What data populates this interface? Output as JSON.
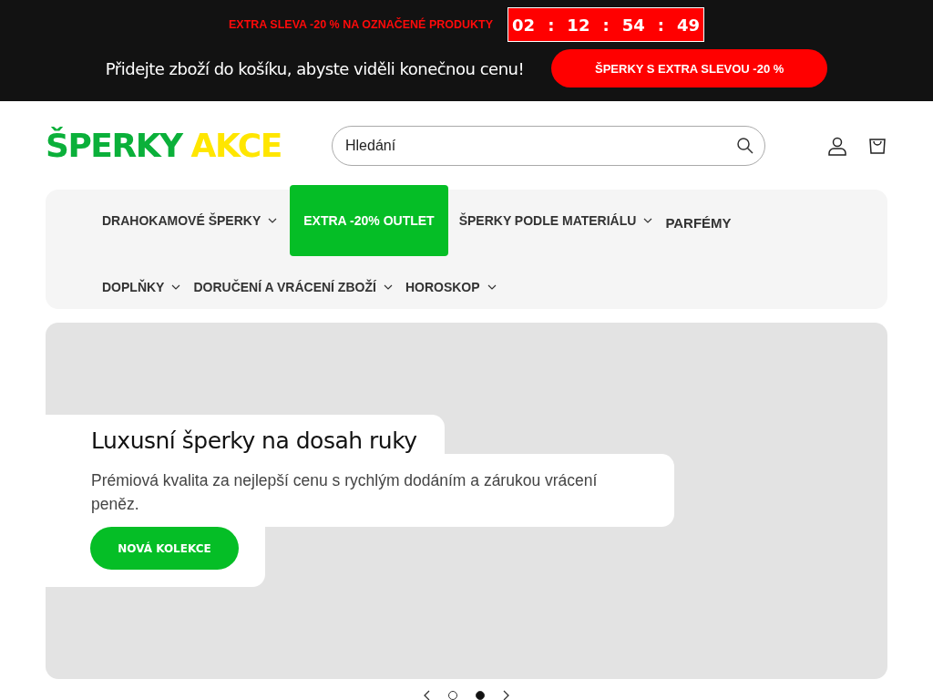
{
  "announcement": {
    "promo_text": "EXTRA SLEVA -20 % NA OZNAČENÉ PRODUKTY",
    "countdown": [
      "02",
      "12",
      "54",
      "49"
    ],
    "separator": ":",
    "cart_hint": "Přidejte zboží do košíku, abyste viděli konečnou cenu!",
    "cta": "ŠPERKY S EXTRA SLEVOU -20 %"
  },
  "header": {
    "logo": [
      "ŠPERKY",
      "AKCE"
    ],
    "search": {
      "placeholder": "Hledání"
    }
  },
  "nav": {
    "items": [
      {
        "label": "DRAHOKAMOVÉ ŠPERKY",
        "kind": "dropdown"
      },
      {
        "label": "EXTRA -20% OUTLET",
        "kind": "highlight"
      },
      {
        "label": "ŠPERKY PODLE MATERIÁLU",
        "kind": "dropdown"
      },
      {
        "label": "PARFÉMY",
        "kind": "link"
      },
      {
        "label": "DOPLŇKY",
        "kind": "dropdown"
      },
      {
        "label": "DORUČENÍ A VRÁCENÍ ZBOŽÍ",
        "kind": "dropdown"
      },
      {
        "label": "HOROSKOP",
        "kind": "dropdown"
      }
    ]
  },
  "hero": {
    "title": "Luxusní šperky na dosah ruky",
    "subtitle": "Prémiová kvalita za nejlepší cenu s rychlým dodáním a zárukou vrácení peněz.",
    "button": "NOVÁ KOLEKCE"
  },
  "slider": {
    "dots": [
      {
        "selected": false
      },
      {
        "selected": true
      }
    ]
  }
}
